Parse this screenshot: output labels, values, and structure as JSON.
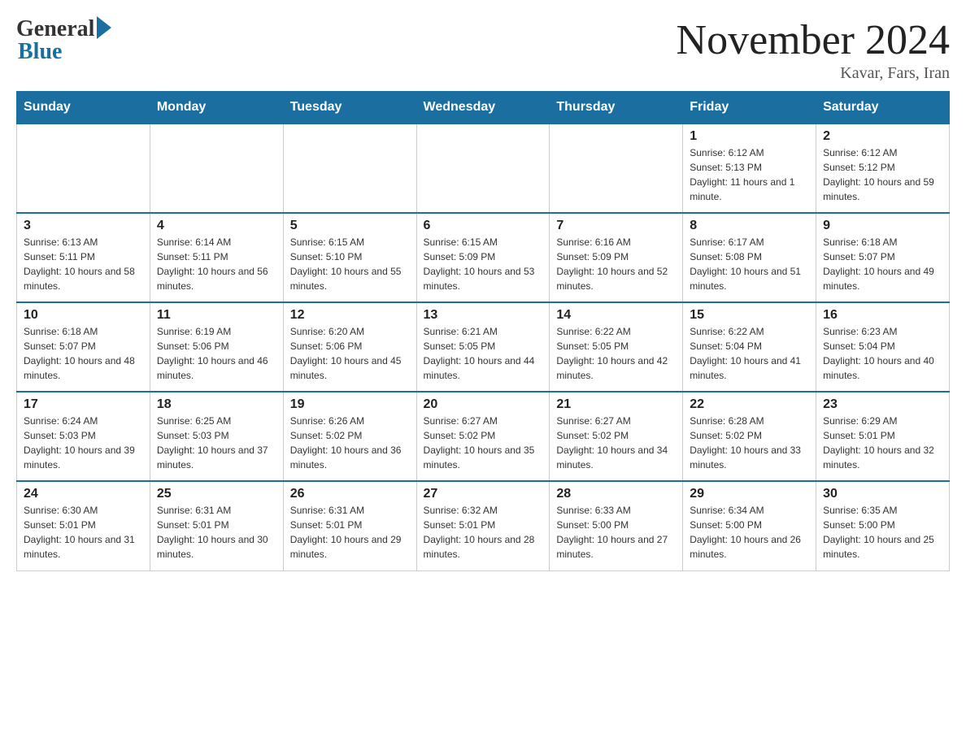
{
  "header": {
    "logo_general": "General",
    "logo_blue": "Blue",
    "month_title": "November 2024",
    "location": "Kavar, Fars, Iran"
  },
  "weekdays": [
    "Sunday",
    "Monday",
    "Tuesday",
    "Wednesday",
    "Thursday",
    "Friday",
    "Saturday"
  ],
  "weeks": [
    [
      {
        "day": "",
        "info": ""
      },
      {
        "day": "",
        "info": ""
      },
      {
        "day": "",
        "info": ""
      },
      {
        "day": "",
        "info": ""
      },
      {
        "day": "",
        "info": ""
      },
      {
        "day": "1",
        "info": "Sunrise: 6:12 AM\nSunset: 5:13 PM\nDaylight: 11 hours and 1 minute."
      },
      {
        "day": "2",
        "info": "Sunrise: 6:12 AM\nSunset: 5:12 PM\nDaylight: 10 hours and 59 minutes."
      }
    ],
    [
      {
        "day": "3",
        "info": "Sunrise: 6:13 AM\nSunset: 5:11 PM\nDaylight: 10 hours and 58 minutes."
      },
      {
        "day": "4",
        "info": "Sunrise: 6:14 AM\nSunset: 5:11 PM\nDaylight: 10 hours and 56 minutes."
      },
      {
        "day": "5",
        "info": "Sunrise: 6:15 AM\nSunset: 5:10 PM\nDaylight: 10 hours and 55 minutes."
      },
      {
        "day": "6",
        "info": "Sunrise: 6:15 AM\nSunset: 5:09 PM\nDaylight: 10 hours and 53 minutes."
      },
      {
        "day": "7",
        "info": "Sunrise: 6:16 AM\nSunset: 5:09 PM\nDaylight: 10 hours and 52 minutes."
      },
      {
        "day": "8",
        "info": "Sunrise: 6:17 AM\nSunset: 5:08 PM\nDaylight: 10 hours and 51 minutes."
      },
      {
        "day": "9",
        "info": "Sunrise: 6:18 AM\nSunset: 5:07 PM\nDaylight: 10 hours and 49 minutes."
      }
    ],
    [
      {
        "day": "10",
        "info": "Sunrise: 6:18 AM\nSunset: 5:07 PM\nDaylight: 10 hours and 48 minutes."
      },
      {
        "day": "11",
        "info": "Sunrise: 6:19 AM\nSunset: 5:06 PM\nDaylight: 10 hours and 46 minutes."
      },
      {
        "day": "12",
        "info": "Sunrise: 6:20 AM\nSunset: 5:06 PM\nDaylight: 10 hours and 45 minutes."
      },
      {
        "day": "13",
        "info": "Sunrise: 6:21 AM\nSunset: 5:05 PM\nDaylight: 10 hours and 44 minutes."
      },
      {
        "day": "14",
        "info": "Sunrise: 6:22 AM\nSunset: 5:05 PM\nDaylight: 10 hours and 42 minutes."
      },
      {
        "day": "15",
        "info": "Sunrise: 6:22 AM\nSunset: 5:04 PM\nDaylight: 10 hours and 41 minutes."
      },
      {
        "day": "16",
        "info": "Sunrise: 6:23 AM\nSunset: 5:04 PM\nDaylight: 10 hours and 40 minutes."
      }
    ],
    [
      {
        "day": "17",
        "info": "Sunrise: 6:24 AM\nSunset: 5:03 PM\nDaylight: 10 hours and 39 minutes."
      },
      {
        "day": "18",
        "info": "Sunrise: 6:25 AM\nSunset: 5:03 PM\nDaylight: 10 hours and 37 minutes."
      },
      {
        "day": "19",
        "info": "Sunrise: 6:26 AM\nSunset: 5:02 PM\nDaylight: 10 hours and 36 minutes."
      },
      {
        "day": "20",
        "info": "Sunrise: 6:27 AM\nSunset: 5:02 PM\nDaylight: 10 hours and 35 minutes."
      },
      {
        "day": "21",
        "info": "Sunrise: 6:27 AM\nSunset: 5:02 PM\nDaylight: 10 hours and 34 minutes."
      },
      {
        "day": "22",
        "info": "Sunrise: 6:28 AM\nSunset: 5:02 PM\nDaylight: 10 hours and 33 minutes."
      },
      {
        "day": "23",
        "info": "Sunrise: 6:29 AM\nSunset: 5:01 PM\nDaylight: 10 hours and 32 minutes."
      }
    ],
    [
      {
        "day": "24",
        "info": "Sunrise: 6:30 AM\nSunset: 5:01 PM\nDaylight: 10 hours and 31 minutes."
      },
      {
        "day": "25",
        "info": "Sunrise: 6:31 AM\nSunset: 5:01 PM\nDaylight: 10 hours and 30 minutes."
      },
      {
        "day": "26",
        "info": "Sunrise: 6:31 AM\nSunset: 5:01 PM\nDaylight: 10 hours and 29 minutes."
      },
      {
        "day": "27",
        "info": "Sunrise: 6:32 AM\nSunset: 5:01 PM\nDaylight: 10 hours and 28 minutes."
      },
      {
        "day": "28",
        "info": "Sunrise: 6:33 AM\nSunset: 5:00 PM\nDaylight: 10 hours and 27 minutes."
      },
      {
        "day": "29",
        "info": "Sunrise: 6:34 AM\nSunset: 5:00 PM\nDaylight: 10 hours and 26 minutes."
      },
      {
        "day": "30",
        "info": "Sunrise: 6:35 AM\nSunset: 5:00 PM\nDaylight: 10 hours and 25 minutes."
      }
    ]
  ]
}
